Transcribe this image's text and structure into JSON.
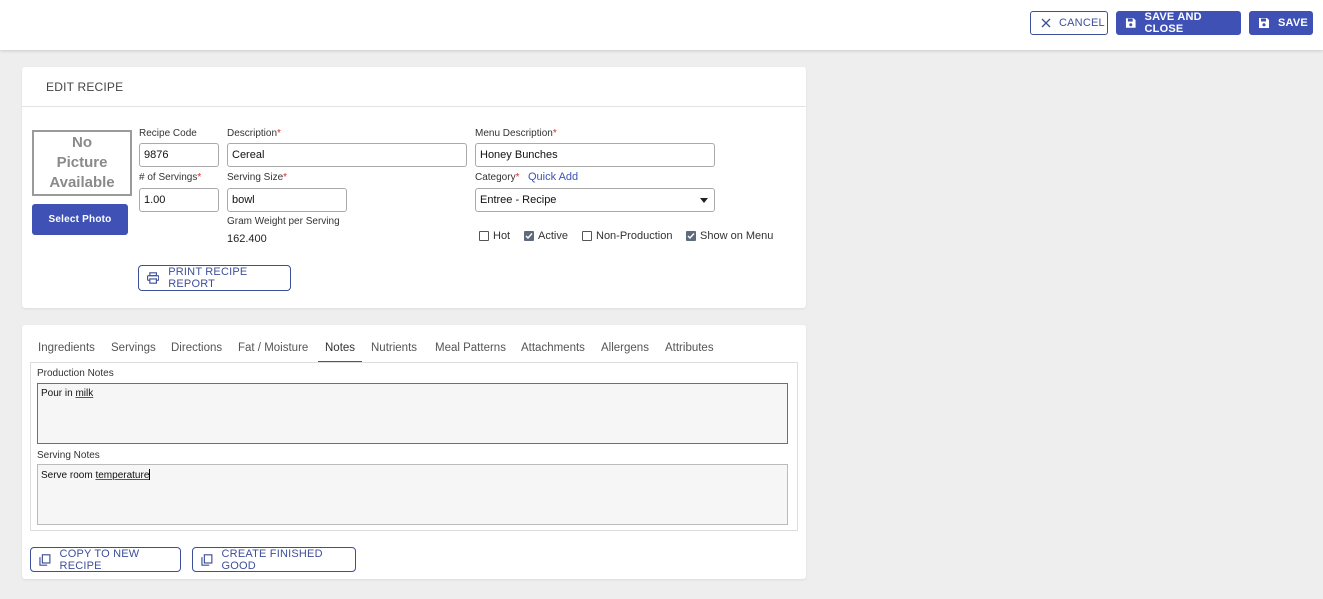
{
  "toolbar": {
    "cancel_label": "CANCEL",
    "save_and_close_label": "SAVE AND CLOSE",
    "save_label": "SAVE"
  },
  "recipe_card": {
    "title": "EDIT RECIPE",
    "no_picture": [
      "No",
      "Picture",
      "Available"
    ],
    "select_photo_label": "Select Photo",
    "recipe_code": {
      "label": "Recipe Code",
      "value": "9876"
    },
    "description": {
      "label": "Description",
      "value": "Cereal"
    },
    "menu_description": {
      "label": "Menu Description",
      "value": "Honey Bunches"
    },
    "servings": {
      "label": "# of Servings",
      "value": "1.00"
    },
    "serving_size": {
      "label": "Serving Size",
      "value": "bowl"
    },
    "gram_weight": {
      "label": "Gram Weight per Serving",
      "value": "162.400"
    },
    "category": {
      "label": "Category",
      "quick_add": "Quick Add",
      "value": "Entree - Recipe"
    },
    "required_mark": "*",
    "checkboxes": [
      {
        "label": "Hot",
        "checked": false
      },
      {
        "label": "Active",
        "checked": true
      },
      {
        "label": "Non-Production",
        "checked": false
      },
      {
        "label": "Show on Menu",
        "checked": true
      }
    ],
    "print_label": "PRINT RECIPE REPORT"
  },
  "tabs": [
    "Ingredients",
    "Servings",
    "Directions",
    "Fat / Moisture",
    "Notes",
    "Nutrients",
    "Meal Patterns",
    "Attachments",
    "Allergens",
    "Attributes"
  ],
  "active_tab": "Notes",
  "notes": {
    "production_label": "Production Notes",
    "production_text_plain": "Pour in ",
    "production_text_link": "milk",
    "serving_label": "Serving Notes",
    "serving_text_plain": "Serve room ",
    "serving_text_link": "temperature"
  },
  "bottom_actions": {
    "copy_label": "COPY TO NEW RECIPE",
    "finished_good_label": "CREATE FINISHED GOOD"
  },
  "colors": {
    "primary": "#3f51b5",
    "required": "#d32f2f",
    "background": "#eeeeee"
  }
}
